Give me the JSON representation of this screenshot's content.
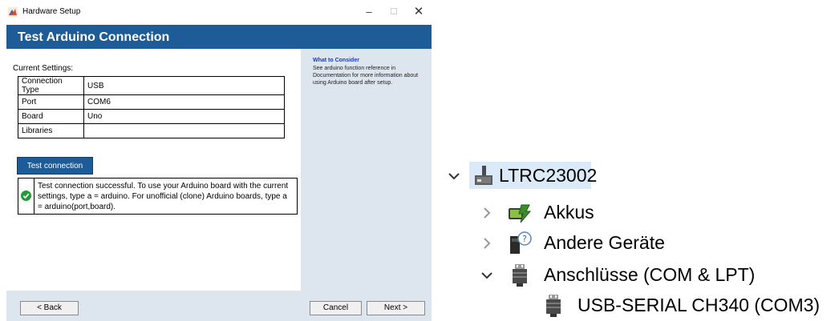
{
  "window": {
    "title": "Hardware Setup",
    "minimize_glyph": "–",
    "maximize_glyph": "☐",
    "close_glyph": "✕"
  },
  "banner": {
    "title": "Test Arduino Connection"
  },
  "settings": {
    "label": "Current Settings:",
    "rows": [
      {
        "key": "Connection Type",
        "value": "USB"
      },
      {
        "key": "Port",
        "value": "COM6"
      },
      {
        "key": "Board",
        "value": "Uno"
      },
      {
        "key": "Libraries",
        "value": ""
      }
    ]
  },
  "test": {
    "button_label": "Test connection",
    "result_text": "Test connection successful. To use your Arduino board with the current settings, type a = arduino. For unofficial (clone) Arduino boards, type a = arduino(port,board).",
    "result_icon": "check-circle-icon"
  },
  "side_panel": {
    "title": "What to Consider",
    "text": "See arduino function reference in Documentation for more information about using Arduino board after setup."
  },
  "footer": {
    "back_label": "< Back",
    "cancel_label": "Cancel",
    "next_label": "Next >"
  },
  "device_tree": {
    "root": {
      "label": "LTRC23002",
      "expanded": true,
      "icon": "computer-icon"
    },
    "items": [
      {
        "label": "Akkus",
        "expanded": false,
        "icon": "battery-icon"
      },
      {
        "label": "Andere Geräte",
        "expanded": false,
        "icon": "unknown-device-icon"
      },
      {
        "label": "Anschlüsse (COM & LPT)",
        "expanded": true,
        "icon": "port-icon"
      }
    ],
    "child": {
      "label": "USB-SERIAL CH340 (COM3)",
      "icon": "port-icon"
    }
  },
  "colors": {
    "banner": "#1d5c96",
    "panel": "#dde5ee",
    "success": "#1f9a3a",
    "selection": "#dbeaf8",
    "link_title": "#1a3bb8"
  }
}
